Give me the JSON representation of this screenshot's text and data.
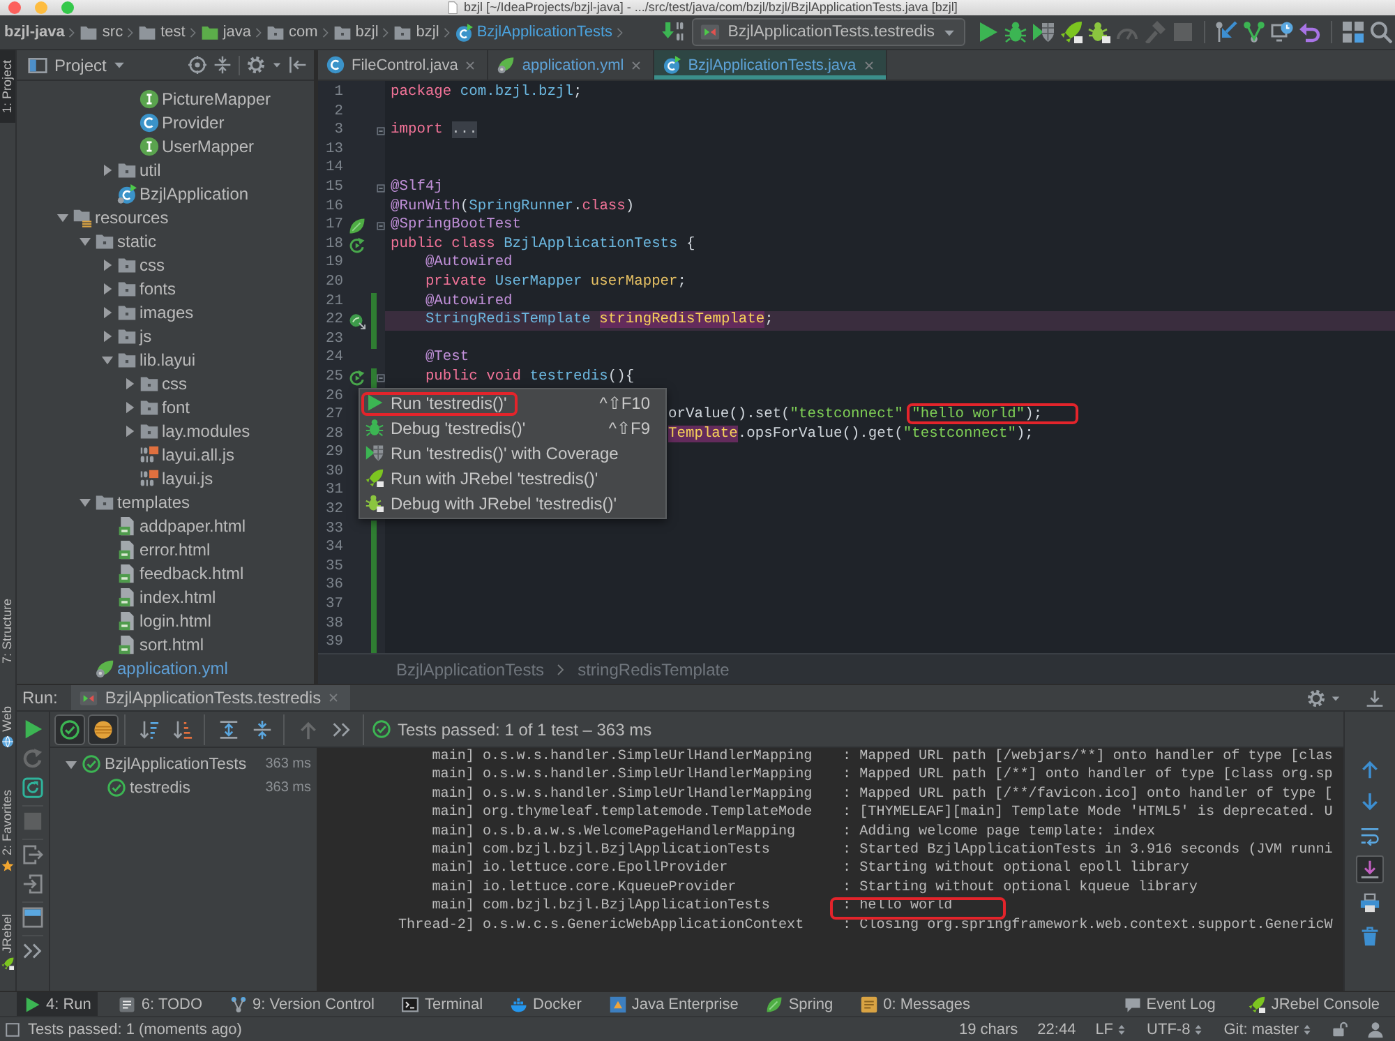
{
  "window": {
    "title": "bzjl [~/IdeaProjects/bzjl-java] - .../src/test/java/com/bzjl/bzjl/BzjlApplicationTests.java [bzjl]"
  },
  "navbar": {
    "breadcrumbs": [
      {
        "label": "bzjl-java",
        "kind": "project",
        "modified": false
      },
      {
        "label": "src",
        "kind": "dir",
        "modified": false
      },
      {
        "label": "test",
        "kind": "dir",
        "modified": false
      },
      {
        "label": "java",
        "kind": "test-folder",
        "modified": false
      },
      {
        "label": "com",
        "kind": "package",
        "modified": false
      },
      {
        "label": "bzjl",
        "kind": "package",
        "modified": false
      },
      {
        "label": "bzjl",
        "kind": "package",
        "modified": false
      },
      {
        "label": "BzjlApplicationTests",
        "kind": "test-class",
        "modified": true
      }
    ],
    "pre_tools": [
      {
        "kind": "build",
        "disabled": false
      }
    ],
    "run_config": "BzjlApplicationTests.testredis",
    "tool_groups": [
      [
        {
          "kind": "run",
          "disabled": false
        },
        {
          "kind": "debug",
          "disabled": false
        },
        {
          "kind": "coverage",
          "disabled": false
        },
        {
          "kind": "jrebel-run",
          "disabled": false
        },
        {
          "kind": "jrebel-debug",
          "disabled": false
        },
        {
          "kind": "profile",
          "disabled": true
        },
        {
          "kind": "attach",
          "disabled": true
        },
        {
          "kind": "stop",
          "disabled": true
        }
      ],
      [
        {
          "kind": "vcs-update",
          "disabled": false
        },
        {
          "kind": "vcs-commit",
          "disabled": false
        },
        {
          "kind": "history",
          "disabled": false
        },
        {
          "kind": "revert",
          "disabled": false
        }
      ],
      [
        {
          "kind": "structure",
          "disabled": false
        },
        {
          "kind": "search",
          "disabled": false
        }
      ]
    ]
  },
  "left_stripe": {
    "top": [
      {
        "label": "1: Project",
        "selected": true
      }
    ],
    "bottom": [
      {
        "label": "7: Structure",
        "kind": "structure",
        "selected": false
      },
      {
        "label": "Web",
        "kind": "web",
        "selected": false
      },
      {
        "label": "2: Favorites",
        "kind": "favorites",
        "selected": false
      },
      {
        "label": "JRebel",
        "kind": "jrebel",
        "selected": false
      }
    ]
  },
  "project": {
    "title": "Project",
    "tree": [
      {
        "children": [
          {
            "children": [
              {
                "children": [
                  {
                    "label": "PictureMapper",
                    "kind": "interface",
                    "modified": false
                  },
                  {
                    "label": "Provider",
                    "kind": "class",
                    "modified": false
                  },
                  {
                    "label": "UserMapper",
                    "kind": "interface",
                    "modified": false
                  }
                ]
              },
              {
                "label": "util",
                "kind": "package",
                "expanded": false,
                "modified": false
              },
              {
                "label": "BzjlApplication",
                "kind": "spring-app",
                "modified": false
              }
            ]
          }
        ]
      },
      {
        "label": "resources",
        "kind": "resource-folder",
        "expanded": true,
        "modified": false,
        "children": [
          {
            "label": "static",
            "kind": "folder",
            "expanded": true,
            "modified": false,
            "children": [
              {
                "label": "css",
                "kind": "folder",
                "expanded": false,
                "modified": false
              },
              {
                "label": "fonts",
                "kind": "folder",
                "expanded": false,
                "modified": false
              },
              {
                "label": "images",
                "kind": "folder",
                "expanded": false,
                "modified": false
              },
              {
                "label": "js",
                "kind": "folder",
                "expanded": false,
                "modified": false
              },
              {
                "label": "lib.layui",
                "kind": "folder",
                "expanded": true,
                "modified": false,
                "children": [
                  {
                    "label": "css",
                    "kind": "folder",
                    "expanded": false,
                    "modified": false
                  },
                  {
                    "label": "font",
                    "kind": "folder",
                    "expanded": false,
                    "modified": false
                  },
                  {
                    "label": "lay.modules",
                    "kind": "folder",
                    "expanded": false,
                    "modified": false
                  },
                  {
                    "label": "layui.all.js",
                    "kind": "js",
                    "modified": false
                  },
                  {
                    "label": "layui.js",
                    "kind": "js",
                    "modified": false
                  }
                ]
              }
            ]
          },
          {
            "label": "templates",
            "kind": "folder",
            "expanded": true,
            "modified": false,
            "children": [
              {
                "label": "addpaper.html",
                "kind": "html",
                "modified": false
              },
              {
                "label": "error.html",
                "kind": "html",
                "modified": false
              },
              {
                "label": "feedback.html",
                "kind": "html",
                "modified": false
              },
              {
                "label": "index.html",
                "kind": "html",
                "modified": false
              },
              {
                "label": "login.html",
                "kind": "html",
                "modified": false
              },
              {
                "label": "sort.html",
                "kind": "html",
                "modified": false
              }
            ]
          },
          {
            "label": "application.yml",
            "kind": "spring-config",
            "modified": true
          }
        ]
      }
    ]
  },
  "editor": {
    "tabs": [
      {
        "label": "FileControl.java",
        "kind": "class",
        "modified": false,
        "selected": false
      },
      {
        "label": "application.yml",
        "kind": "spring-config",
        "modified": true,
        "selected": false
      },
      {
        "label": "BzjlApplicationTests.java",
        "kind": "test-class",
        "modified": true,
        "selected": true
      }
    ],
    "lines": [
      {
        "number": "1",
        "current": false,
        "changed": false,
        "fold": false,
        "tokens": [
          {
            "kind": "keyword",
            "text": "package "
          },
          {
            "kind": "package",
            "text": "com.bzjl.bzjl"
          },
          {
            "kind": "plain",
            "text": ";"
          }
        ]
      },
      {
        "number": "2",
        "current": false,
        "changed": false,
        "fold": false
      },
      {
        "number": "3",
        "current": false,
        "changed": false,
        "fold": true,
        "tokens": [
          {
            "kind": "keyword",
            "text": "import "
          },
          {
            "kind": "folded",
            "text": "..."
          }
        ]
      },
      {
        "number": "13",
        "current": false,
        "changed": false,
        "fold": false
      },
      {
        "number": "14",
        "current": false,
        "changed": false,
        "fold": false
      },
      {
        "number": "15",
        "current": false,
        "changed": false,
        "fold": true,
        "tokens": [
          {
            "kind": "annotation",
            "text": "@Slf4j"
          }
        ]
      },
      {
        "number": "16",
        "current": false,
        "changed": false,
        "fold": false,
        "tokens": [
          {
            "kind": "annotation",
            "text": "@RunWith"
          },
          {
            "kind": "plain",
            "text": "("
          },
          {
            "kind": "type",
            "text": "SpringRunner"
          },
          {
            "kind": "plain",
            "text": "."
          },
          {
            "kind": "keyword",
            "text": "class"
          },
          {
            "kind": "plain",
            "text": ")"
          }
        ]
      },
      {
        "number": "17",
        "current": false,
        "changed": false,
        "fold": true,
        "gutter": {
          "kind": "spring"
        },
        "tokens": [
          {
            "kind": "annotation",
            "text": "@SpringBootTest"
          }
        ]
      },
      {
        "number": "18",
        "current": false,
        "changed": false,
        "fold": false,
        "gutter": {
          "kind": "run"
        },
        "tokens": [
          {
            "kind": "keyword",
            "text": "public class "
          },
          {
            "kind": "type",
            "text": "BzjlApplicationTests"
          },
          {
            "kind": "plain",
            "text": " {"
          }
        ]
      },
      {
        "number": "19",
        "current": false,
        "changed": false,
        "fold": false,
        "tokens": [
          {
            "kind": "annotation",
            "text": "    @Autowired"
          }
        ]
      },
      {
        "number": "20",
        "current": false,
        "changed": false,
        "fold": false,
        "tokens": [
          {
            "kind": "keyword",
            "text": "    private "
          },
          {
            "kind": "type",
            "text": "UserMapper "
          },
          {
            "kind": "field",
            "text": "userMapper"
          },
          {
            "kind": "plain",
            "text": ";"
          }
        ]
      },
      {
        "number": "21",
        "current": false,
        "changed": true,
        "fold": false,
        "tokens": [
          {
            "kind": "annotation",
            "text": "    @Autowired"
          }
        ]
      },
      {
        "number": "22",
        "current": true,
        "changed": true,
        "fold": false,
        "gutter": {
          "kind": "bean"
        },
        "tokens": [
          {
            "kind": "type",
            "text": "    StringRedisTemplate "
          },
          {
            "kind": "usage",
            "text": "stringRedisTemplate"
          },
          {
            "kind": "plain",
            "text": ";"
          }
        ]
      },
      {
        "number": "23",
        "current": false,
        "changed": true,
        "fold": false
      },
      {
        "number": "24",
        "current": false,
        "changed": false,
        "fold": false,
        "tokens": [
          {
            "kind": "annotation",
            "text": "    @Test"
          }
        ]
      },
      {
        "number": "25",
        "current": false,
        "changed": true,
        "fold": true,
        "gutter": {
          "kind": "run"
        },
        "tokens": [
          {
            "kind": "keyword",
            "text": "    public void "
          },
          {
            "kind": "method",
            "text": "testredis"
          },
          {
            "kind": "plain",
            "text": "(){"
          }
        ]
      },
      {
        "number": "26",
        "current": false,
        "fold": false
      },
      {
        "number": "27",
        "current": false,
        "fold": false,
        "tokens": [
          {
            "kind": "plain",
            "text": "orValue().set(",
            "annotated": false
          },
          {
            "kind": "string",
            "text": "\"testconnect\" ",
            "annotated": false
          },
          {
            "kind": "string",
            "text": "\"hello world\"",
            "annotated": true
          },
          {
            "kind": "plain",
            "text": ");",
            "annotated": false
          }
        ]
      },
      {
        "number": "28",
        "current": false,
        "fold": false,
        "tokens": [
          {
            "kind": "usage",
            "text": "Template"
          },
          {
            "kind": "plain",
            "text": ".opsForValue().get("
          },
          {
            "kind": "string",
            "text": "\"testconnect\""
          },
          {
            "kind": "plain",
            "text": ");"
          }
        ]
      },
      {
        "number": "29",
        "current": false,
        "fold": false
      },
      {
        "number": "30",
        "current": false,
        "fold": false
      },
      {
        "number": "31",
        "current": false,
        "fold": false
      },
      {
        "number": "32",
        "current": false,
        "fold": false
      },
      {
        "number": "33",
        "current": false,
        "changed": true,
        "fold": false
      },
      {
        "number": "34",
        "current": false,
        "changed": true,
        "fold": false
      },
      {
        "number": "35",
        "current": false,
        "changed": true,
        "fold": false
      },
      {
        "number": "36",
        "current": false,
        "changed": true,
        "fold": false
      },
      {
        "number": "37",
        "current": false,
        "changed": true,
        "fold": false
      },
      {
        "number": "38",
        "current": false,
        "changed": true,
        "fold": false
      },
      {
        "number": "39",
        "current": false,
        "changed": true,
        "fold": false
      }
    ],
    "context_menu": {
      "items": [
        {
          "label": "Run 'testredis()'",
          "shortcut": "^⇧F10",
          "kind": "run",
          "annotated": true
        },
        {
          "label": "Debug 'testredis()'",
          "shortcut": "^⇧F9",
          "kind": "debug",
          "annotated": false
        },
        {
          "label": "Run 'testredis()' with Coverage",
          "kind": "coverage",
          "annotated": false
        },
        {
          "label": "Run with JRebel 'testredis()'",
          "kind": "jrebel-run",
          "annotated": false
        },
        {
          "label": "Debug with JRebel 'testredis()'",
          "kind": "jrebel-debug",
          "annotated": false
        }
      ]
    },
    "breadcrumbs": [
      "BzjlApplicationTests",
      "stringRedisTemplate"
    ]
  },
  "run": {
    "title": "Run:",
    "tab": "BzjlApplicationTests.testredis",
    "side_tool_groups": [
      [
        {
          "kind": "rerun",
          "disabled": false
        },
        {
          "kind": "rerun-failed",
          "disabled": true
        },
        {
          "kind": "auto-test",
          "disabled": false
        }
      ],
      [
        {
          "kind": "stop",
          "disabled": true
        }
      ],
      [
        {
          "kind": "export",
          "disabled": false
        },
        {
          "kind": "import",
          "disabled": false
        }
      ],
      [
        {
          "kind": "layout",
          "disabled": false
        }
      ],
      [
        {
          "kind": "more",
          "disabled": false
        }
      ]
    ],
    "test_tool_groups": [
      [
        {
          "kind": "show-passed",
          "on": true,
          "disabled": false
        },
        {
          "kind": "show-ignored",
          "on": true,
          "disabled": false
        }
      ],
      [
        {
          "kind": "sort-alpha",
          "on": false,
          "disabled": false
        },
        {
          "kind": "sort-duration",
          "on": false,
          "disabled": false
        }
      ],
      [
        {
          "kind": "expand-all",
          "on": false,
          "disabled": false
        },
        {
          "kind": "collapse-all",
          "on": false,
          "disabled": false
        }
      ],
      [
        {
          "kind": "previous",
          "on": false,
          "disabled": true
        },
        {
          "kind": "more",
          "on": false,
          "disabled": false
        }
      ]
    ],
    "status": "Tests passed: 1 of 1 test – 363 ms",
    "tests": [
      {
        "label": "BzjlApplicationTests",
        "time": "363 ms",
        "passed": true,
        "expanded": true,
        "children": [
          {
            "label": "testredis",
            "time": "363 ms",
            "passed": true
          }
        ]
      }
    ],
    "console": [
      {
        "thread": "main]",
        "logger": "o.s.w.s.handler.SimpleUrlHandlerMapping",
        "message": ": Mapped URL path [/webjars/**] onto handler of type [clas",
        "annotated": false
      },
      {
        "thread": "main]",
        "logger": "o.s.w.s.handler.SimpleUrlHandlerMapping",
        "message": ": Mapped URL path [/**] onto handler of type [class org.sp",
        "annotated": false
      },
      {
        "thread": "main]",
        "logger": "o.s.w.s.handler.SimpleUrlHandlerMapping",
        "message": ": Mapped URL path [/**/favicon.ico] onto handler of type [",
        "annotated": false
      },
      {
        "thread": "main]",
        "logger": "org.thymeleaf.templatemode.TemplateMode",
        "message": ": [THYMELEAF][main] Template Mode 'HTML5' is deprecated. U",
        "annotated": false
      },
      {
        "thread": "main]",
        "logger": "o.s.b.a.w.s.WelcomePageHandlerMapping",
        "message": ": Adding welcome page template: index",
        "annotated": false
      },
      {
        "thread": "main]",
        "logger": "com.bzjl.bzjl.BzjlApplicationTests",
        "message": ": Started BzjlApplicationTests in 3.916 seconds (JVM runni",
        "annotated": false
      },
      {
        "thread": "main]",
        "logger": "io.lettuce.core.EpollProvider",
        "message": ": Starting without optional epoll library",
        "annotated": false
      },
      {
        "thread": "main]",
        "logger": "io.lettuce.core.KqueueProvider",
        "message": ": Starting without optional kqueue library",
        "annotated": false
      },
      {
        "thread": "main]",
        "logger": "com.bzjl.bzjl.BzjlApplicationTests",
        "message": ": hello world",
        "annotated": true
      },
      {
        "thread": "Thread-2]",
        "logger": "o.s.w.c.s.GenericWebApplicationContext",
        "message": ": Closing org.springframework.web.context.support.GenericW",
        "annotated": false
      }
    ],
    "console_tools": [
      {
        "kind": "up",
        "on": false
      },
      {
        "kind": "down",
        "on": false
      },
      {
        "kind": "soft-wrap",
        "on": false
      },
      {
        "kind": "scroll-end",
        "on": true
      },
      {
        "kind": "print",
        "on": false
      },
      {
        "kind": "clear",
        "on": false
      }
    ]
  },
  "tool_windows": {
    "left": [
      {
        "label": "4: Run",
        "kind": "run",
        "selected": true
      },
      {
        "label": "6: TODO",
        "kind": "todo",
        "selected": false
      },
      {
        "label": "9: Version Control",
        "kind": "vcs",
        "selected": false
      },
      {
        "label": "Terminal",
        "kind": "terminal",
        "selected": false
      },
      {
        "label": "Docker",
        "kind": "docker",
        "selected": false
      },
      {
        "label": "Java Enterprise",
        "kind": "java-ee",
        "selected": false
      },
      {
        "label": "Spring",
        "kind": "spring",
        "selected": false
      },
      {
        "label": "0: Messages",
        "kind": "messages",
        "selected": false
      }
    ],
    "right": [
      {
        "label": "Event Log",
        "kind": "event-log",
        "selected": false
      },
      {
        "label": "JRebel Console",
        "kind": "jrebel",
        "selected": false
      }
    ]
  },
  "status_bar": {
    "message": "Tests passed: 1 (moments ago)",
    "widgets": [
      {
        "label": "19 chars",
        "kind": "text"
      },
      {
        "label": "22:44",
        "kind": "text"
      },
      {
        "label": "LF",
        "kind": "dropdown"
      },
      {
        "label": "UTF-8",
        "kind": "dropdown"
      },
      {
        "label": "Git: master",
        "kind": "dropdown"
      }
    ]
  }
}
